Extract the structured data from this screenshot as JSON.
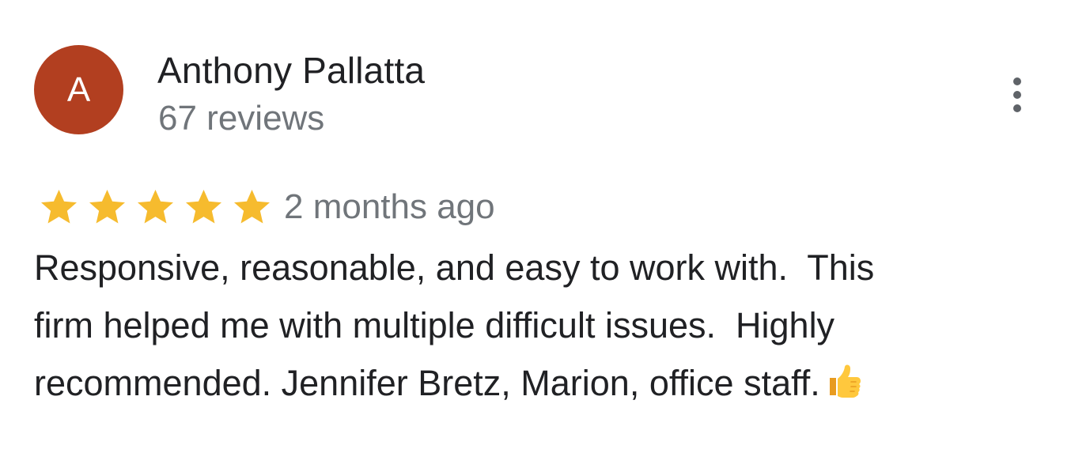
{
  "review": {
    "author": {
      "initial": "A",
      "name": "Anthony Pallatta",
      "review_count": "67 reviews",
      "avatar_color": "#b23f20"
    },
    "more_options_icon": "more-vert-icon",
    "rating": {
      "stars": 5,
      "max_stars": 5,
      "star_icon": "star-icon",
      "star_color": "#f6bb2e"
    },
    "date": "2 months ago",
    "text_lines": [
      "Responsive, reasonable, and easy to work with.  This",
      "firm helped me with multiple difficult issues.  Highly",
      "recommended. Jennifer Bretz, Marion, office staff."
    ],
    "trailing_emoji": "thumbs-up-icon"
  },
  "colors": {
    "primary_text": "#202124",
    "secondary_text": "#70757a",
    "icon_gray": "#5f6368"
  }
}
